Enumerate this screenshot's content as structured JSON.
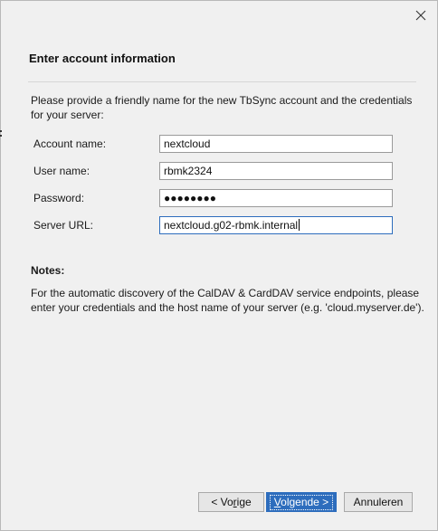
{
  "window": {
    "close_icon": "close-icon"
  },
  "header": {
    "title": "Enter account information"
  },
  "intro": {
    "text": "Please provide a friendly name for the new TbSync account and the credentials for your server:"
  },
  "form": {
    "account_name": {
      "label": "Account name:",
      "value": "nextcloud"
    },
    "user_name": {
      "label": "User name:",
      "value": "rbmk2324"
    },
    "password": {
      "label": "Password:",
      "value": "●●●●●●●●"
    },
    "server_url": {
      "label": "Server URL:",
      "value": "nextcloud.g02-rbmk.internal"
    }
  },
  "notes": {
    "title": "Notes:",
    "text": "For the automatic discovery of the CalDAV & CardDAV service endpoints, please enter your credentials and the host name of your server (e.g. 'cloud.myserver.de')."
  },
  "buttons": {
    "back_pre": "< Vo",
    "back_accel": "r",
    "back_post": "ige",
    "next_pre": "",
    "next_accel": "V",
    "next_post": "olgende >",
    "cancel": "Annuleren"
  },
  "colors": {
    "accent": "#2d6dbd",
    "background": "#f0f0f0"
  }
}
